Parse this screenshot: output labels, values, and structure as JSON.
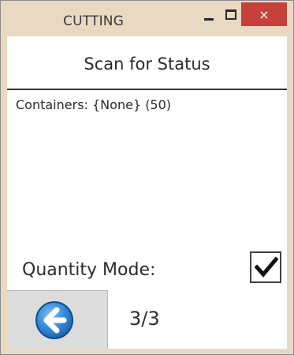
{
  "window": {
    "title": "CUTTING",
    "controls": {
      "minimize": "minimize-icon",
      "maximize": "maximize-icon",
      "close": "×"
    }
  },
  "header": {
    "title": "Scan for Status"
  },
  "containers": {
    "text": "Containers:  {None} (50)"
  },
  "quantity_mode": {
    "label": "Quantity Mode:",
    "checked": true
  },
  "navigation": {
    "back_icon": "back-arrow-icon",
    "page": "3/3"
  },
  "colors": {
    "titlebar": "#ead9c2",
    "close_button": "#c5413a",
    "accent_blue": "#2f86d6"
  }
}
